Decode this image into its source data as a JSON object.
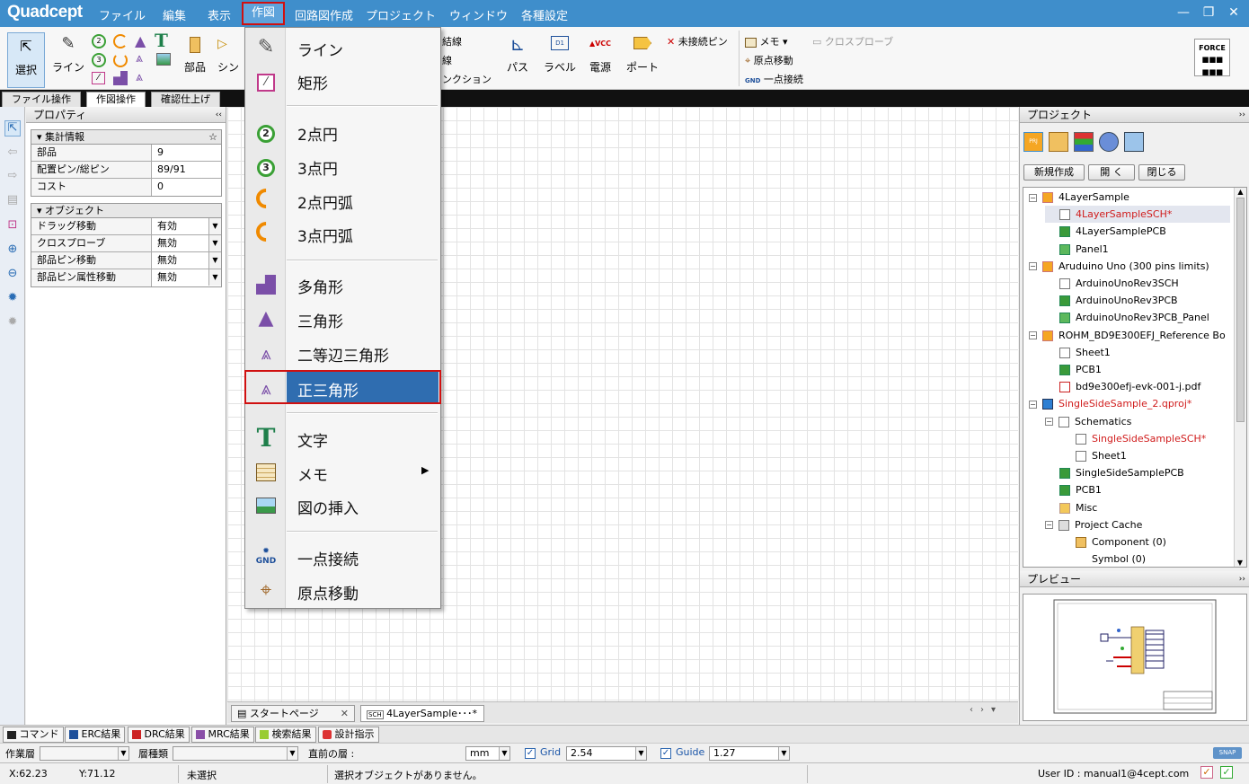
{
  "app": {
    "logo": "Quadcept"
  },
  "menubar": {
    "items": [
      "ファイル",
      "編集",
      "表示",
      "作図",
      "回路図作成",
      "プロジェクト",
      "ウィンドウ",
      "各種設定"
    ]
  },
  "window_controls": {
    "minimize": "—",
    "restore": "❐",
    "close": "✕"
  },
  "ribbon": {
    "select": "選択",
    "line": "ライン",
    "part": "部品",
    "symbol_partial": "シン",
    "wire_partial": "結線",
    "bus_partial": "線",
    "junction_partial": "ンクション",
    "bus": "パス",
    "label": "ラベル",
    "power": "電源",
    "port": "ポート",
    "noconnect": "未接続ピン",
    "memo": "メモ ▾",
    "origin": "原点移動",
    "gnd": "一点接続",
    "crossprobe": "クロスプローブ",
    "force": "FORCE"
  },
  "ribbon_tabs": [
    "ファイル操作",
    "作図操作",
    "確認仕上げ"
  ],
  "properties": {
    "header": "プロパティ",
    "sec1": "集計情報",
    "sec1_rows": [
      [
        "部品",
        "9"
      ],
      [
        "配置ピン/総ピン",
        "89/91"
      ],
      [
        "コスト",
        "0"
      ]
    ],
    "sec2": "オブジェクト",
    "sec2_rows": [
      [
        "ドラッグ移動",
        "有効"
      ],
      [
        "クロスプローブ",
        "無効"
      ],
      [
        "部品ピン移動",
        "無効"
      ],
      [
        "部品ピン属性移動",
        "無効"
      ]
    ]
  },
  "doc_tabs": [
    "スタートページ",
    "4LayerSample･･･*"
  ],
  "project": {
    "header": "プロジェクト",
    "buttons": [
      "新規作成",
      "開 く",
      "閉じる"
    ],
    "tree": [
      {
        "label": "4LayerSample",
        "level": 0,
        "icon": "PRJ",
        "exp": "⊟"
      },
      {
        "label": "4LayerSampleSCH*",
        "level": 1,
        "icon": "SCH",
        "red": true,
        "sel": true
      },
      {
        "label": "4LayerSamplePCB",
        "level": 1,
        "icon": "PCB"
      },
      {
        "label": "Panel1",
        "level": 1,
        "icon": "PNL"
      },
      {
        "label": "Aruduino Uno (300 pins limits)",
        "level": 0,
        "icon": "PRJ",
        "exp": "⊟"
      },
      {
        "label": "ArduinoUnoRev3SCH",
        "level": 1,
        "icon": "SCH"
      },
      {
        "label": "ArduinoUnoRev3PCB",
        "level": 1,
        "icon": "PCB"
      },
      {
        "label": "ArduinoUnoRev3PCB_Panel",
        "level": 1,
        "icon": "PNL"
      },
      {
        "label": "ROHM_BD9E300EFJ_Reference Bo",
        "level": 0,
        "icon": "PRJ",
        "exp": "⊟"
      },
      {
        "label": "Sheet1",
        "level": 1,
        "icon": "SCH"
      },
      {
        "label": "PCB1",
        "level": 1,
        "icon": "PCB"
      },
      {
        "label": "bd9e300efj-evk-001-j.pdf",
        "level": 1,
        "icon": "PDF"
      },
      {
        "label": "SingleSideSample_2.qproj*",
        "level": 0,
        "icon": "QPJ",
        "red": true,
        "exp": "⊟"
      },
      {
        "label": "Schematics",
        "level": 1,
        "icon": "SCH",
        "exp": "⊟"
      },
      {
        "label": "SingleSideSampleSCH*",
        "level": 2,
        "icon": "SCH",
        "red": true
      },
      {
        "label": "Sheet1",
        "level": 2,
        "icon": "SCH"
      },
      {
        "label": "SingleSideSamplePCB",
        "level": 1,
        "icon": "PCB"
      },
      {
        "label": "PCB1",
        "level": 1,
        "icon": "PCB"
      },
      {
        "label": "Misc",
        "level": 1,
        "icon": "DIR"
      },
      {
        "label": "Project Cache",
        "level": 1,
        "icon": "DB",
        "exp": "⊟"
      },
      {
        "label": "Component (0)",
        "level": 2,
        "icon": "CMP"
      },
      {
        "label": "Symbol (0)",
        "level": 2,
        "icon": "SYM"
      }
    ],
    "preview_header": "プレビュー"
  },
  "bottom_tabs": [
    "コマンド",
    "ERC結果",
    "DRC結果",
    "MRC結果",
    "検索結果",
    "設計指示"
  ],
  "layerbar": {
    "work_layer_label": "作業層",
    "layer_type_label": "層種類",
    "direct_layer_label": "直前の層 :",
    "unit": "mm",
    "grid_label": "Grid",
    "grid_value": "2.54",
    "guide_label": "Guide",
    "guide_value": "1.27",
    "snap": "SNAP"
  },
  "status": {
    "x": "X:62.23",
    "y": "Y:71.12",
    "sel": "未選択",
    "msg": "選択オブジェクトがありません。",
    "user": "User ID : manual1@4cept.com"
  },
  "dropdown": {
    "items": [
      {
        "label": "ライン",
        "icon": "pen-icon"
      },
      {
        "label": "矩形",
        "icon": "rect-icon"
      },
      {
        "label": "2点円",
        "icon": "circle2-icon"
      },
      {
        "label": "3点円",
        "icon": "circle3-icon"
      },
      {
        "label": "2点円弧",
        "icon": "arc2-icon"
      },
      {
        "label": "3点円弧",
        "icon": "arc3-icon"
      },
      {
        "label": "多角形",
        "icon": "polygon-icon"
      },
      {
        "label": "三角形",
        "icon": "triangle-icon"
      },
      {
        "label": "二等辺三角形",
        "icon": "isosceles-icon"
      },
      {
        "label": "正三角形",
        "icon": "equilateral-icon"
      },
      {
        "label": "文字",
        "icon": "text-icon"
      },
      {
        "label": "メモ",
        "icon": "memo-icon"
      },
      {
        "label": "図の挿入",
        "icon": "image-icon"
      },
      {
        "label": "一点接続",
        "icon": "gnd-icon"
      },
      {
        "label": "原点移動",
        "icon": "origin-icon"
      }
    ]
  },
  "colors": {
    "titlebar": "#3f8ecb",
    "highlight": "#2f6db0",
    "alert_border": "#d01010"
  }
}
